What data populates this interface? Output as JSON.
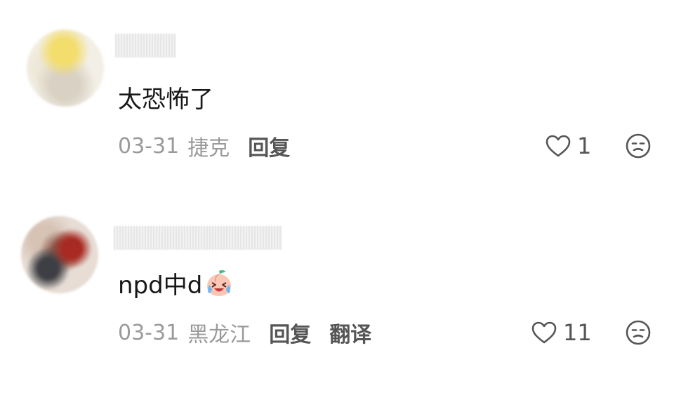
{
  "comments": [
    {
      "text": "太恐怖了",
      "date": "03-31",
      "location": "捷克",
      "reply_label": "回复",
      "likes": "1"
    },
    {
      "text": "npd中d",
      "emoji_icon": "crying-laughing-peach-emoji",
      "date": "03-31",
      "location": "黑龙江",
      "reply_label": "回复",
      "translate_label": "翻译",
      "likes": "11"
    }
  ],
  "icons": {
    "like": "heart-outline-icon",
    "dislike": "unamused-face-icon"
  },
  "colors": {
    "text": "#171717",
    "meta": "#9a9a9a",
    "action": "#555555"
  }
}
